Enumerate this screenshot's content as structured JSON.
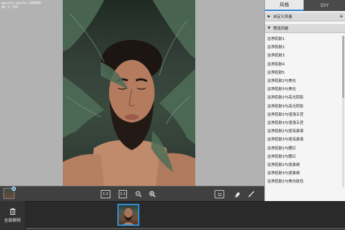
{
  "canvas": {
    "file_info_line1": "macole-photo-CEBBBB",
    "file_info_line2": "W0 X 750"
  },
  "toolbar": {
    "fit_label": "1:1",
    "actual_label": "1:1",
    "zoom_out_icon": "zoom-out-icon",
    "zoom_in_icon": "zoom-in-icon",
    "face_icon": "face-icon",
    "eraser_icon": "eraser-icon",
    "brush_icon": "brush-icon"
  },
  "panel": {
    "tabs": [
      {
        "label": "风格",
        "active": true
      },
      {
        "label": "DIY",
        "active": false
      }
    ],
    "custom_section": {
      "label": "自定义风格",
      "arrow": "▶",
      "plus": "+"
    },
    "preset_section": {
      "label": "预设风格",
      "arrow": "▼"
    },
    "items": [
      "洁净肌肤1",
      "洁净肌肤2",
      "洁净肌肤3",
      "洁净肌肤4",
      "洁净肌肤5",
      "洁净肌肤2与美化",
      "洁净肌肤3与美化",
      "洁净肌肤2与高光阴影",
      "洁净肌肤3与高光阴影",
      "洁净肌肤2与增强五官",
      "洁净肌肤3与增强五官",
      "洁净肌肤2与提亮鼻梁",
      "洁净肌肤3与提亮鼻梁",
      "洁净肌肤2与腮红",
      "洁净肌肤3与腮红",
      "洁净肌肤2与提鼻颊",
      "洁净肌肤3与提鼻颊",
      "洁净肌肤2与美白肤色"
    ]
  },
  "bottom": {
    "remove_all_label": "全部移除"
  },
  "colors": {
    "accent": "#2f7fd1",
    "canvas_bg": "#b2b2b2",
    "panel_bg": "#f5f5f5",
    "dark_bg": "#2a2a2a"
  }
}
